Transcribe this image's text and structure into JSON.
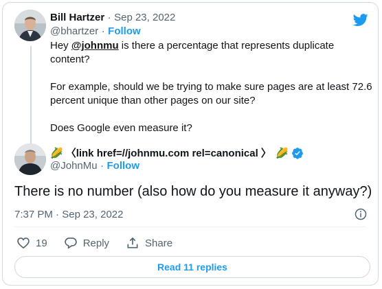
{
  "first_tweet": {
    "author_name": "Bill Hartzer",
    "separator": "·",
    "date": "Sep 23, 2022",
    "handle": "@bhartzer",
    "follow_label": "Follow",
    "text_prefix": "Hey ",
    "mention": "@johnmu",
    "text_line1_suffix": " is there a percentage that represents duplicate",
    "text_line2": "content?",
    "text_para2_line1": "For example, should we be trying to make sure pages are at least 72.6",
    "text_para2_line2": "percent unique than other pages on our site?",
    "text_para3": "Does Google even measure it?"
  },
  "reply_tweet": {
    "emoji_left": "🌽",
    "author_name": "〈link href=//johnmu.com rel=canonical 〉",
    "emoji_right": "🌽",
    "verified_icon": "verified-badge-icon",
    "handle": "@JohnMu",
    "follow_label": "Follow",
    "text": "There is no number (also how do you measure it anyway?)",
    "time": "7:37 PM",
    "date": "Sep 23, 2022"
  },
  "actions": {
    "like_count": "19",
    "reply_label": "Reply",
    "share_label": "Share"
  },
  "read_replies_label": "Read 11 replies",
  "colors": {
    "accent": "#1d9bf0",
    "text": "#0f1419",
    "muted": "#536471",
    "border": "#cfd9de"
  }
}
